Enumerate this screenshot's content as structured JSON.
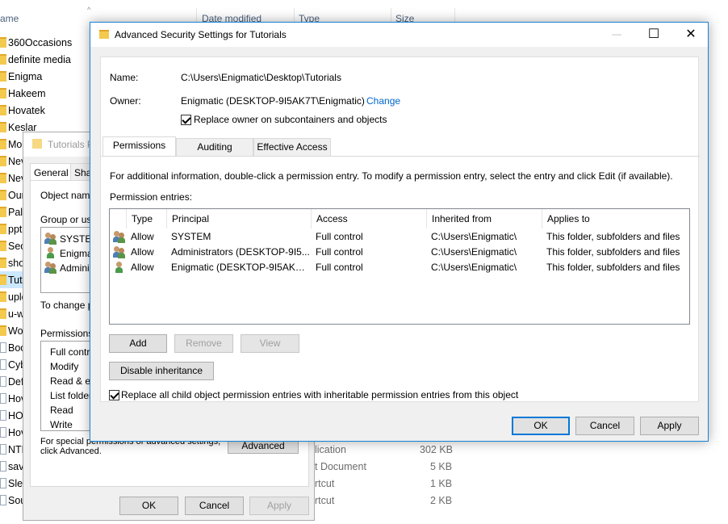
{
  "explorer": {
    "columns": [
      "ame",
      "Date modified",
      "Type",
      "Size"
    ],
    "files": [
      {
        "name": "360Occasions",
        "type": "folder"
      },
      {
        "name": "definite media",
        "type": "folder"
      },
      {
        "name": "Enigma",
        "type": "folder"
      },
      {
        "name": "Hakeem",
        "type": "folder"
      },
      {
        "name": "Hovatek",
        "type": "folder"
      },
      {
        "name": "Keslar",
        "type": "folder"
      },
      {
        "name": "Mo",
        "type": "folder"
      },
      {
        "name": "Nev",
        "type": "folder"
      },
      {
        "name": "Nev",
        "type": "folder"
      },
      {
        "name": "Our",
        "type": "folder"
      },
      {
        "name": "Palc",
        "type": "folder"
      },
      {
        "name": "ppt",
        "type": "folder"
      },
      {
        "name": "Sec",
        "type": "folder"
      },
      {
        "name": "sho",
        "type": "folder"
      },
      {
        "name": "Tut",
        "type": "folder",
        "selected": true
      },
      {
        "name": "uplo",
        "type": "folder"
      },
      {
        "name": "u-w",
        "type": "folder"
      },
      {
        "name": "Wo",
        "type": "folder"
      },
      {
        "name": "Boo",
        "type": "file"
      },
      {
        "name": "Cyb",
        "type": "file"
      },
      {
        "name": "Def",
        "type": "file"
      },
      {
        "name": "Hov",
        "type": "file"
      },
      {
        "name": "HO",
        "type": "file"
      },
      {
        "name": "Hov",
        "type": "file"
      },
      {
        "name": "NTF",
        "type": "file"
      },
      {
        "name": "sav",
        "type": "file"
      },
      {
        "name": "Slee",
        "type": "file"
      },
      {
        "name": "Sou",
        "type": "file"
      }
    ],
    "bg_types": [
      "lication",
      "t Document",
      "rtcut",
      "rtcut"
    ],
    "bg_sizes": [
      "302 KB",
      "5 KB",
      "1 KB",
      "2 KB"
    ]
  },
  "props": {
    "title": "Tutorials P",
    "tabs": [
      "General",
      "Sha"
    ],
    "object_name_label": "Object name",
    "group_label": "Group or use",
    "groups": [
      "SYSTEM",
      "Enigmat",
      "Administ"
    ],
    "change_label": "To change p",
    "permissions_label": "Permissions f",
    "permissions": [
      "Full contro",
      "Modify",
      "Read & ex",
      "List folder",
      "Read",
      "Write"
    ],
    "special_text_1": "For special permissions or advanced settings,",
    "special_text_2": "click Advanced.",
    "advanced_label": "Advanced",
    "ok_label": "OK",
    "cancel_label": "Cancel",
    "apply_label": "Apply"
  },
  "adv": {
    "title": "Advanced Security Settings for Tutorials",
    "minimize_glyph": "—",
    "maximize_glyph": "☐",
    "close_glyph": "✕",
    "name_label": "Name:",
    "name_value": "C:\\Users\\Enigmatic\\Desktop\\Tutorials",
    "owner_label": "Owner:",
    "owner_value": "Enigmatic (DESKTOP-9I5AK7T\\Enigmatic)",
    "change_link": "Change",
    "replace_owner_label": "Replace owner on subcontainers and objects",
    "replace_owner_checked": true,
    "tabs": [
      "Permissions",
      "Auditing",
      "Effective Access"
    ],
    "info_text": "For additional information, double-click a permission entry. To modify a permission entry, select the entry and click Edit (if available).",
    "entries_label": "Permission entries:",
    "columns": [
      "Type",
      "Principal",
      "Access",
      "Inherited from",
      "Applies to"
    ],
    "entries": [
      {
        "icon": "group",
        "type": "Allow",
        "principal": "SYSTEM",
        "access": "Full control",
        "inherited": "C:\\Users\\Enigmatic\\",
        "applies": "This folder, subfolders and files"
      },
      {
        "icon": "group",
        "type": "Allow",
        "principal": "Administrators (DESKTOP-9I5...",
        "access": "Full control",
        "inherited": "C:\\Users\\Enigmatic\\",
        "applies": "This folder, subfolders and files"
      },
      {
        "icon": "user",
        "type": "Allow",
        "principal": "Enigmatic (DESKTOP-9I5AK7T...",
        "access": "Full control",
        "inherited": "C:\\Users\\Enigmatic\\",
        "applies": "This folder, subfolders and files"
      }
    ],
    "add_label": "Add",
    "remove_label": "Remove",
    "view_label": "View",
    "disable_inheritance_label": "Disable inheritance",
    "replace_child_label": "Replace all child object permission entries with inheritable permission entries from this object",
    "replace_child_checked": true,
    "ok_label": "OK",
    "cancel_label": "Cancel",
    "apply_label": "Apply"
  }
}
